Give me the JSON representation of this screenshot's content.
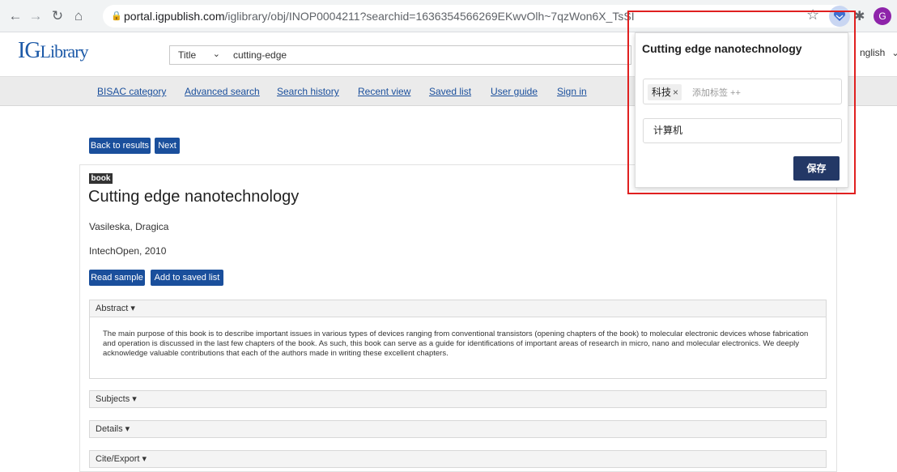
{
  "browser": {
    "url_host": "portal.igpublish.com",
    "url_path": "/iglibrary/obj/INOP0004211?searchid=1636354566269EKwvOlh~7qzWon6X_TsSI",
    "profile_initial": "G"
  },
  "site": {
    "logo_main": "IG",
    "logo_rest": "Library",
    "search_type": "Title",
    "search_query": "cutting-edge",
    "language": "nglish"
  },
  "nav": {
    "items": [
      "BISAC category",
      "Advanced search",
      "Search history",
      "Recent view",
      "Saved list",
      "User guide",
      "Sign in"
    ]
  },
  "page": {
    "back_button": "Back to results",
    "next_button": "Next",
    "badge": "book",
    "title": "Cutting edge nanotechnology",
    "author": "Vasileska, Dragica",
    "publisher": "IntechOpen, 2010",
    "read_sample": "Read sample",
    "add_saved": "Add to saved list",
    "abstract_label": "Abstract ▾",
    "abstract_text": "The main purpose of this book is to describe important issues in various types of devices ranging from conventional transistors (opening chapters of the book) to molecular electronic devices whose fabrication and operation is discussed in the last few chapters of the book. As such, this book can serve as a guide for identifications of important areas of research in micro, nano and molecular electronics. We deeply acknowledge valuable contributions that each of the authors made in writing these excellent chapters.",
    "subjects_label": "Subjects ▾",
    "details_label": "Details ▾",
    "cite_label": "Cite/Export ▾"
  },
  "popup": {
    "title": "Cutting edge nanotechnology",
    "tag": "科技",
    "tag_remove": "×",
    "add_tag_placeholder": "添加标签 ++",
    "category": "计算机",
    "save": "保存"
  },
  "colors": {
    "accent_blue": "#1a4f9c",
    "highlight_red": "#e02020",
    "save_button": "#233866"
  }
}
